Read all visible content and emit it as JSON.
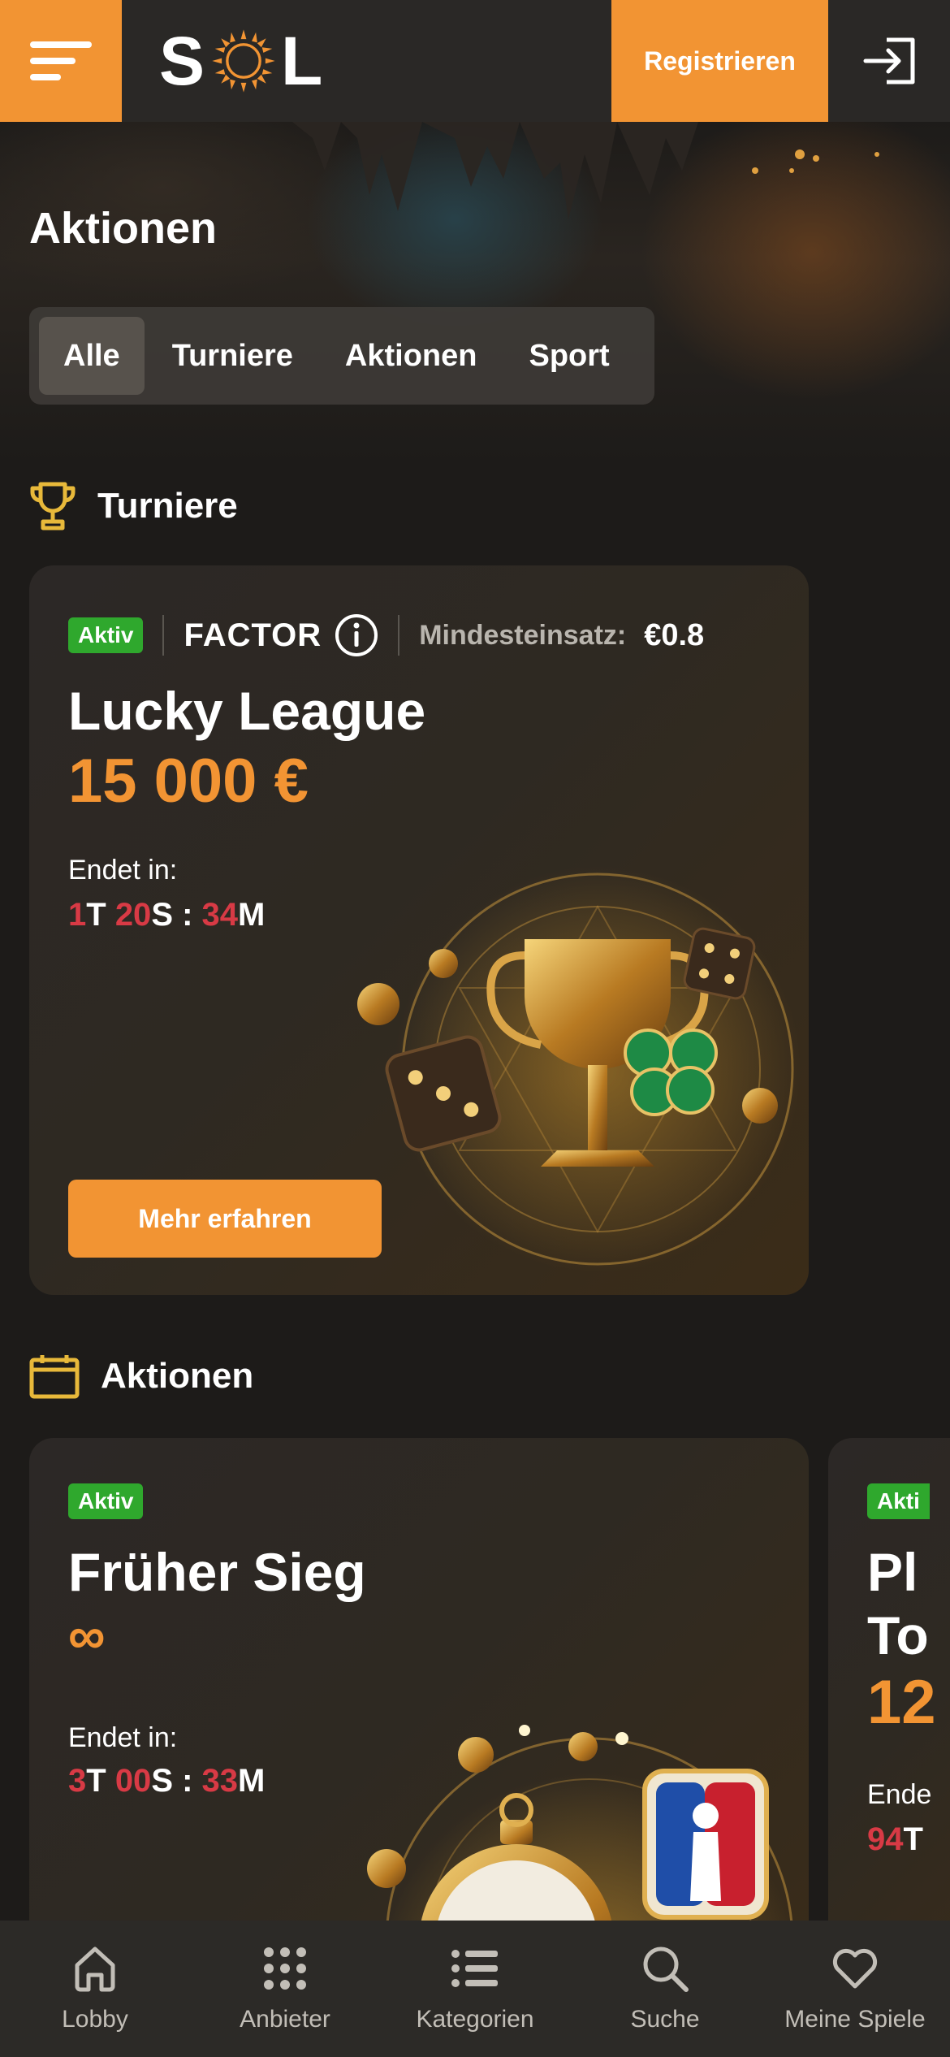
{
  "header": {
    "logo_left": "S",
    "logo_right": "L",
    "register_label": "Registrieren"
  },
  "page": {
    "title": "Aktionen"
  },
  "tabs": [
    {
      "label": "Alle",
      "active": true
    },
    {
      "label": "Turniere",
      "active": false
    },
    {
      "label": "Aktionen",
      "active": false
    },
    {
      "label": "Sport",
      "active": false
    }
  ],
  "tournaments": {
    "heading": "Turniere",
    "icon": "trophy-icon",
    "card": {
      "status": "Aktiv",
      "provider": "FACTOR",
      "min_bet_label": "Mindesteinsatz:",
      "min_bet_value": "€0.8",
      "title": "Lucky League",
      "prize": "15 000 €",
      "ends_label": "Endet in:",
      "timer": {
        "d": "1",
        "d_unit": "T",
        "h": "20",
        "h_unit": "S",
        "sep": " : ",
        "m": "34",
        "m_unit": "M"
      },
      "button": "Mehr erfahren"
    }
  },
  "promotions": {
    "heading": "Aktionen",
    "icon": "calendar-icon",
    "cards": [
      {
        "status": "Aktiv",
        "title": "Früher Sieg",
        "prize": "∞",
        "ends_label": "Endet in:",
        "timer": {
          "d": "3",
          "d_unit": "T",
          "h": "00",
          "h_unit": "S",
          "sep": " : ",
          "m": "33",
          "m_unit": "M"
        }
      },
      {
        "status": "Akti",
        "title_line1": "Pl",
        "title_line2": "To",
        "prize": "12",
        "ends_label": "Ende",
        "timer_num": "94",
        "timer_unit": "T"
      }
    ]
  },
  "bottom_nav": [
    {
      "label": "Lobby",
      "icon": "home-icon"
    },
    {
      "label": "Anbieter",
      "icon": "grid-icon"
    },
    {
      "label": "Kategorien",
      "icon": "list-icon"
    },
    {
      "label": "Suche",
      "icon": "search-icon"
    },
    {
      "label": "Meine Spiele",
      "icon": "heart-icon"
    }
  ],
  "colors": {
    "accent": "#f29433",
    "background": "#1d1b19",
    "active_badge": "#2fa82d",
    "timer_red": "#d83a45"
  }
}
